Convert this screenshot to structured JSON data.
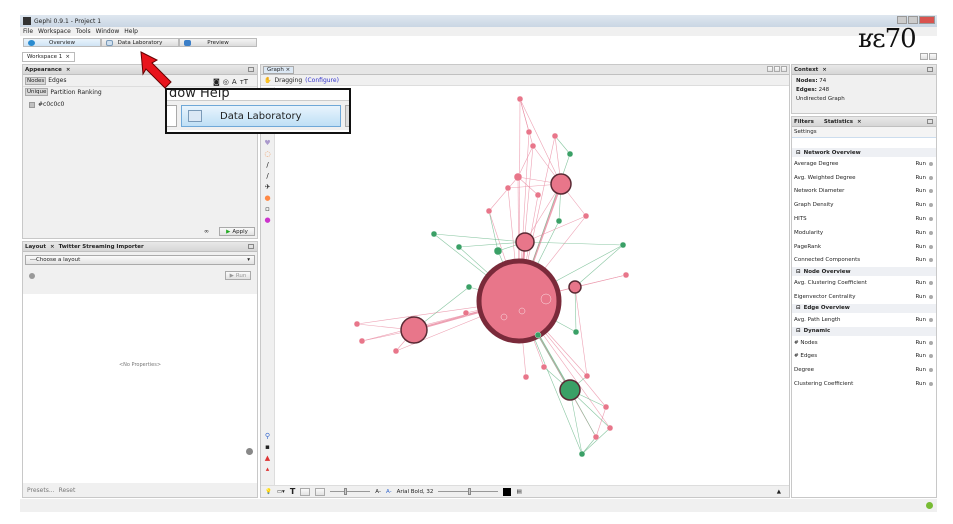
{
  "window": {
    "title": "Gephi 0.9.1 - Project 1"
  },
  "menu": [
    "File",
    "Workspace",
    "Tools",
    "Window",
    "Help"
  ],
  "modes": [
    {
      "label": "Overview"
    },
    {
      "label": "Data Laboratory"
    },
    {
      "label": "Preview"
    }
  ],
  "workspace_tab": "Workspace 1",
  "appearance": {
    "title": "Appearance",
    "tabs": [
      "Nodes",
      "Edges"
    ],
    "subtabs": [
      "Unique",
      "Partition",
      "Ranking"
    ],
    "color_value": "#c0c0c0",
    "apply_label": "Apply"
  },
  "layout": {
    "tabs": [
      "Layout",
      "Twitter Streaming Importer"
    ],
    "select_value": "---Choose a layout",
    "run_label": "Run",
    "no_properties": "<No Properties>",
    "presets_label": "Presets...",
    "reset_label": "Reset"
  },
  "graph": {
    "tab": "Graph",
    "mode_label": "Dragging",
    "configure_label": "(Configure)",
    "font_label": "Arial Bold, 32",
    "node_color": "#e8768a",
    "node_color_green": "#3aa066",
    "hub_stroke": "#7a2a3a"
  },
  "callout": {
    "menu_text": "dow   Help",
    "button_label": "Data Laboratory"
  },
  "context": {
    "title": "Context",
    "nodes_label": "Nodes:",
    "nodes_value": "74",
    "edges_label": "Edges:",
    "edges_value": "248",
    "graph_type": "Undirected Graph"
  },
  "statistics": {
    "tabs": [
      "Filters",
      "Statistics"
    ],
    "settings_label": "Settings",
    "run_label": "Run",
    "sections": [
      {
        "title": "Network Overview",
        "items": [
          "Average Degree",
          "Avg. Weighted Degree",
          "Network Diameter",
          "Graph Density",
          "HITS",
          "Modularity",
          "PageRank",
          "Connected Components"
        ]
      },
      {
        "title": "Node Overview",
        "items": [
          "Avg. Clustering Coefficient",
          "Eigenvector Centrality"
        ]
      },
      {
        "title": "Edge Overview",
        "items": [
          "Avg. Path Length"
        ]
      },
      {
        "title": "Dynamic",
        "items": [
          "# Nodes",
          "# Edges",
          "Degree",
          "Clustering Coefficient"
        ]
      }
    ]
  },
  "logo_text": "ʁɛ70",
  "arrow_color": "#e8141c"
}
